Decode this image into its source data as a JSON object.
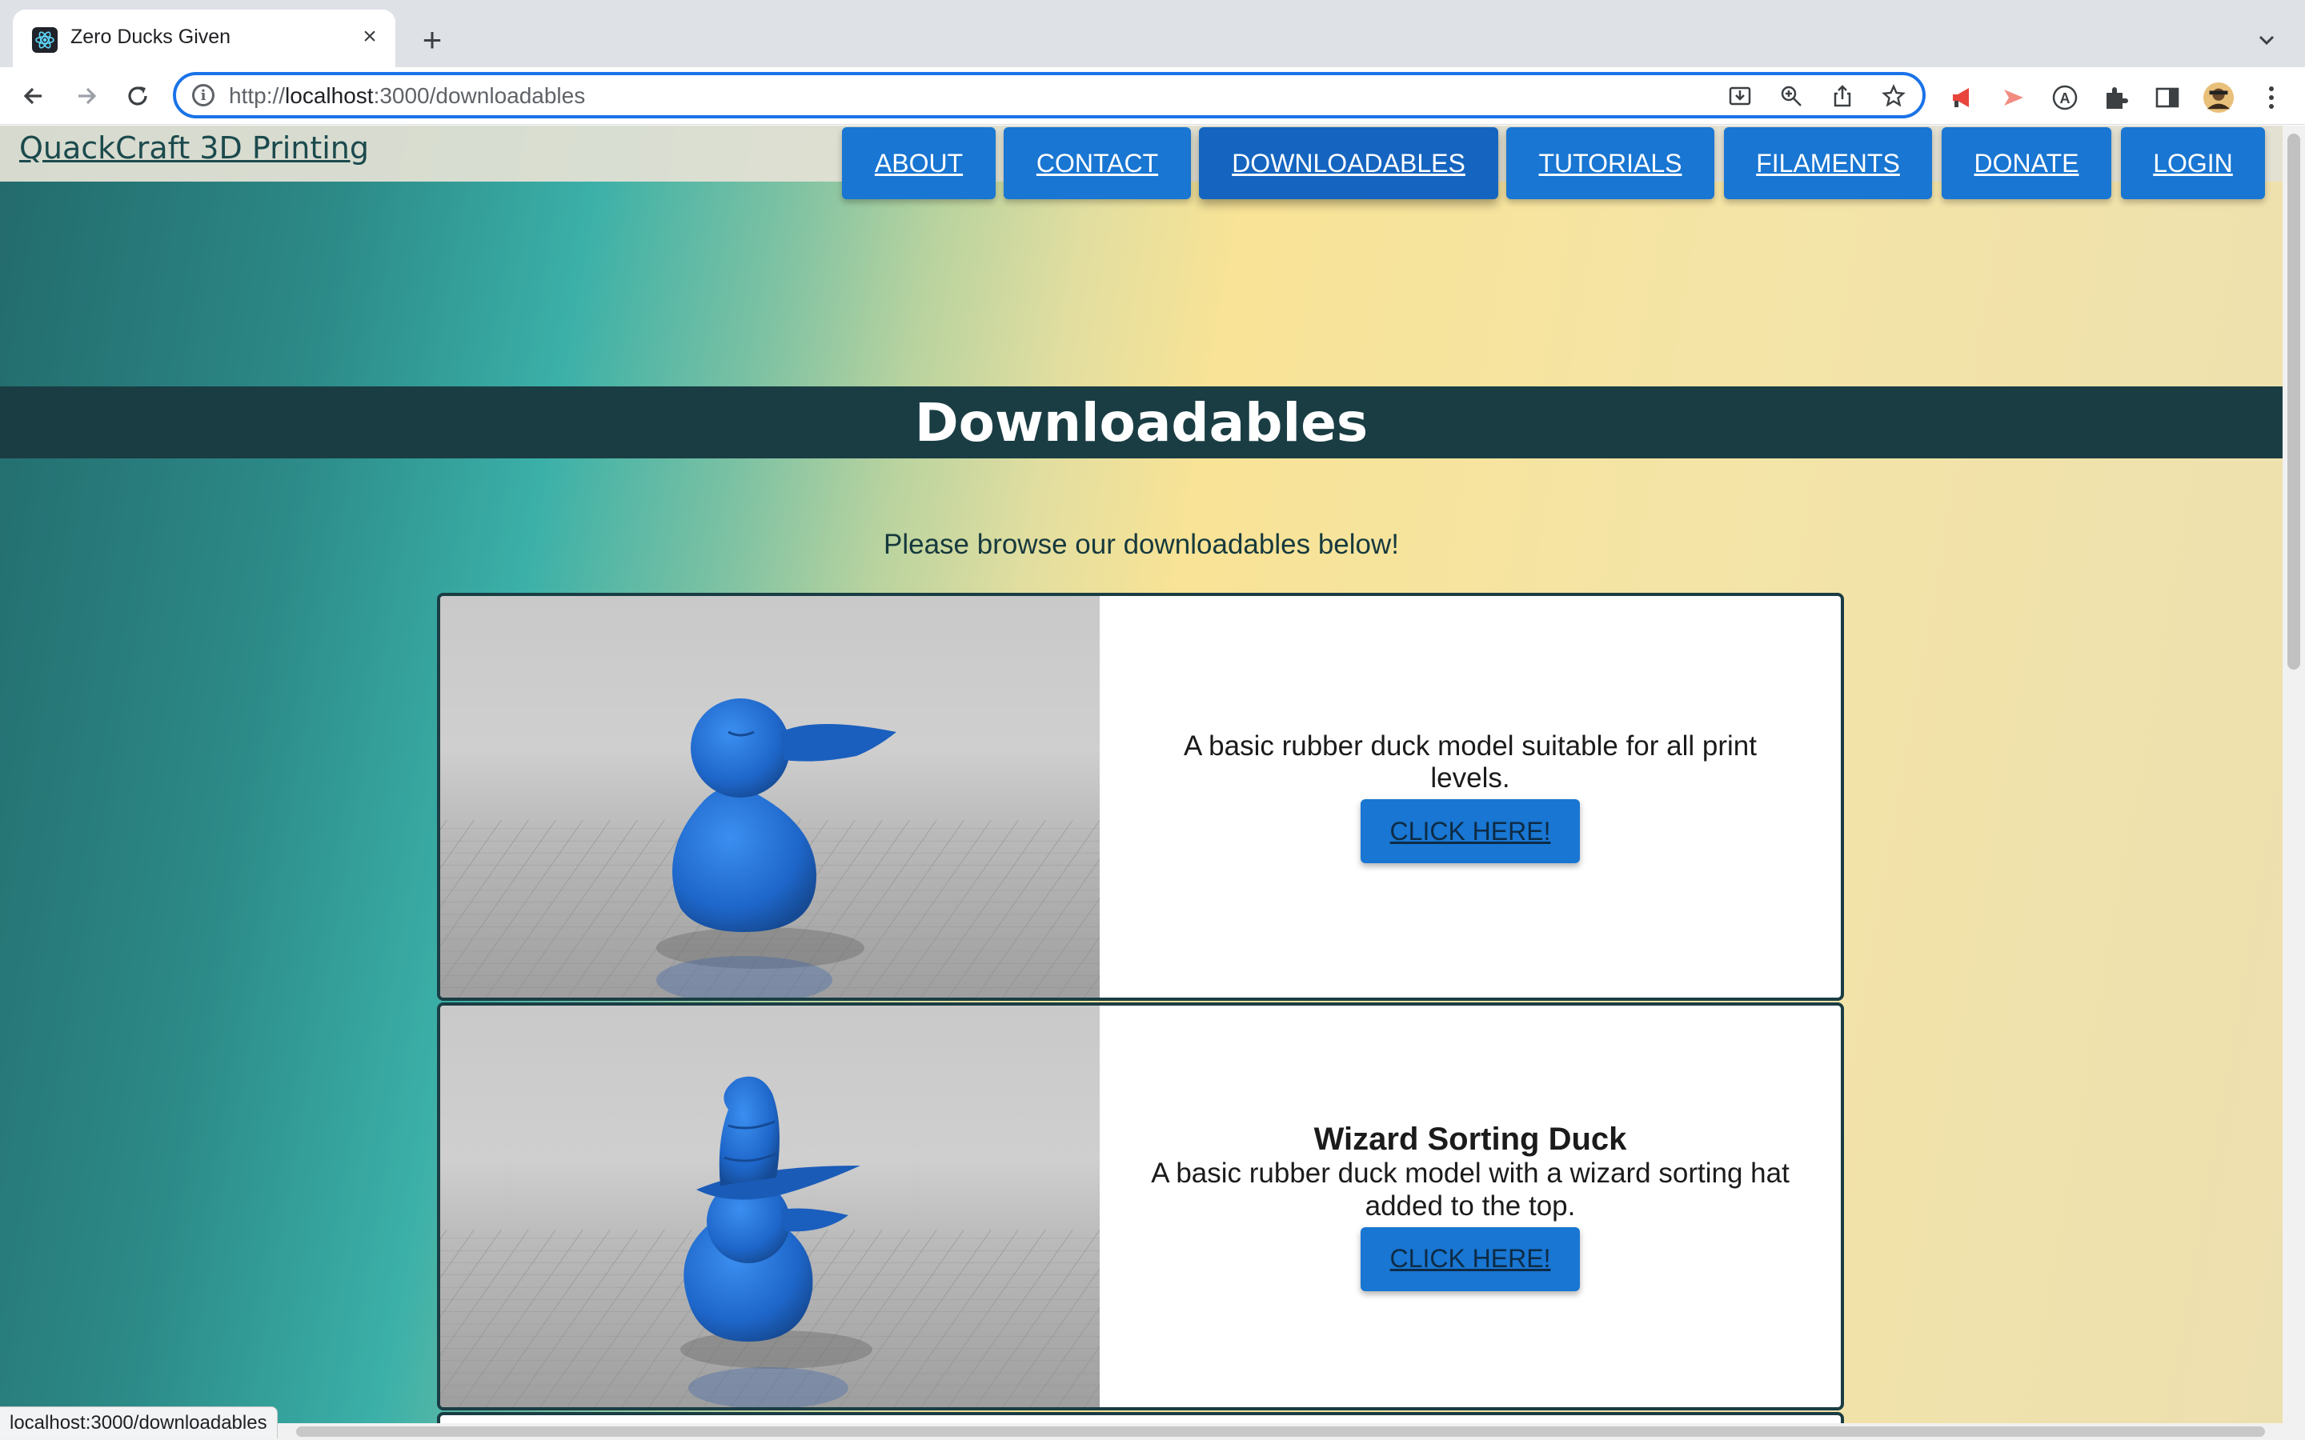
{
  "browser": {
    "tab_title": "Zero Ducks Given",
    "url_prefix": "http://",
    "url_host": "localhost",
    "url_rest": ":3000/downloadables",
    "status_url": "localhost:3000/downloadables",
    "accent_color": "#1a73e8"
  },
  "site": {
    "brand": "QuackCraft 3D Printing",
    "nav": [
      {
        "label": "ABOUT"
      },
      {
        "label": "CONTACT"
      },
      {
        "label": "DOWNLOADABLES",
        "active": true
      },
      {
        "label": "TUTORIALS"
      },
      {
        "label": "FILAMENTS"
      },
      {
        "label": "DONATE"
      },
      {
        "label": "LOGIN"
      }
    ],
    "button_color": "#1976d2",
    "banner_color": "#1a3d44"
  },
  "page": {
    "title": "Downloadables",
    "intro": "Please browse our downloadables below!",
    "items": [
      {
        "title": "",
        "description": "A basic rubber duck model suitable for all print levels.",
        "button_label": "CLICK HERE!",
        "image_icon": "rubber-duck-render"
      },
      {
        "title": "Wizard Sorting Duck",
        "description": "A basic rubber duck model with a wizard sorting hat added to the top.",
        "button_label": "CLICK HERE!",
        "image_icon": "wizard-duck-render"
      }
    ]
  }
}
